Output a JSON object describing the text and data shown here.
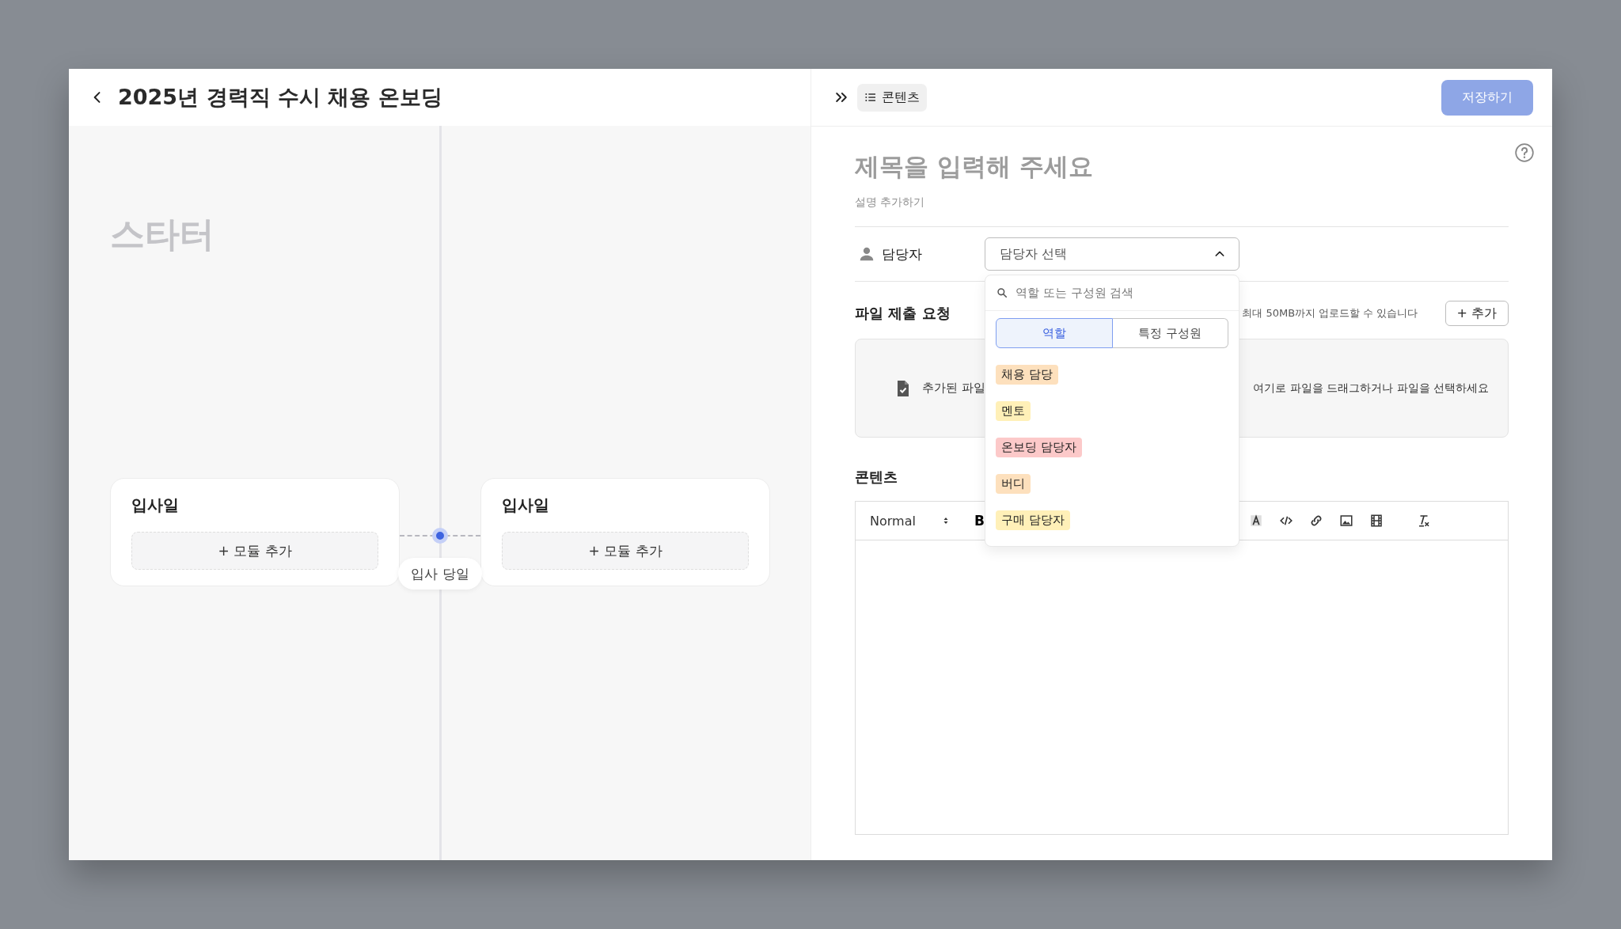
{
  "title": "2025년 경력직 수시 채용 온보딩",
  "canvas": {
    "stage_title": "스타터",
    "cards": [
      {
        "title": "입사일",
        "add_label": "+ 모듈 추가"
      },
      {
        "title": "입사일",
        "add_label": "+ 모듈 추가"
      }
    ],
    "milestone": {
      "label": "입사 당일"
    }
  },
  "panel": {
    "contents_chip": "콘텐츠",
    "save_button": {
      "label": "저장하기",
      "disabled": true
    },
    "title_placeholder": "제목을 입력해 주세요",
    "description_placeholder": "설명 추가하기",
    "assignee": {
      "label": "담당자",
      "placeholder": "담당자 선택",
      "expanded": true
    },
    "dropdown": {
      "search_placeholder": "역할 또는 구성원 검색",
      "tabs": [
        {
          "label": "역할",
          "selected": true
        },
        {
          "label": "특정 구성원",
          "selected": false
        }
      ],
      "roles": [
        {
          "label": "채용 담당",
          "color": "#fde0bd"
        },
        {
          "label": "멘토",
          "color": "#fff0b8"
        },
        {
          "label": "온보딩 담당자",
          "color": "#fcc9c9"
        },
        {
          "label": "버디",
          "color": "#fde0bd"
        },
        {
          "label": "구매 담당자",
          "color": "#fff0b8"
        }
      ]
    },
    "file_request": {
      "title": "파일 제출 요청",
      "note": "최대 50MB까지 업로드할 수 있습니다",
      "add_button": "+ 추가",
      "added_label": "추가된 파일",
      "drop_hint": "여기로 파일을 드래그하거나 파일을 선택하세요"
    },
    "contents": {
      "title": "콘텐츠",
      "format": "Normal",
      "bold_button": "B"
    }
  }
}
